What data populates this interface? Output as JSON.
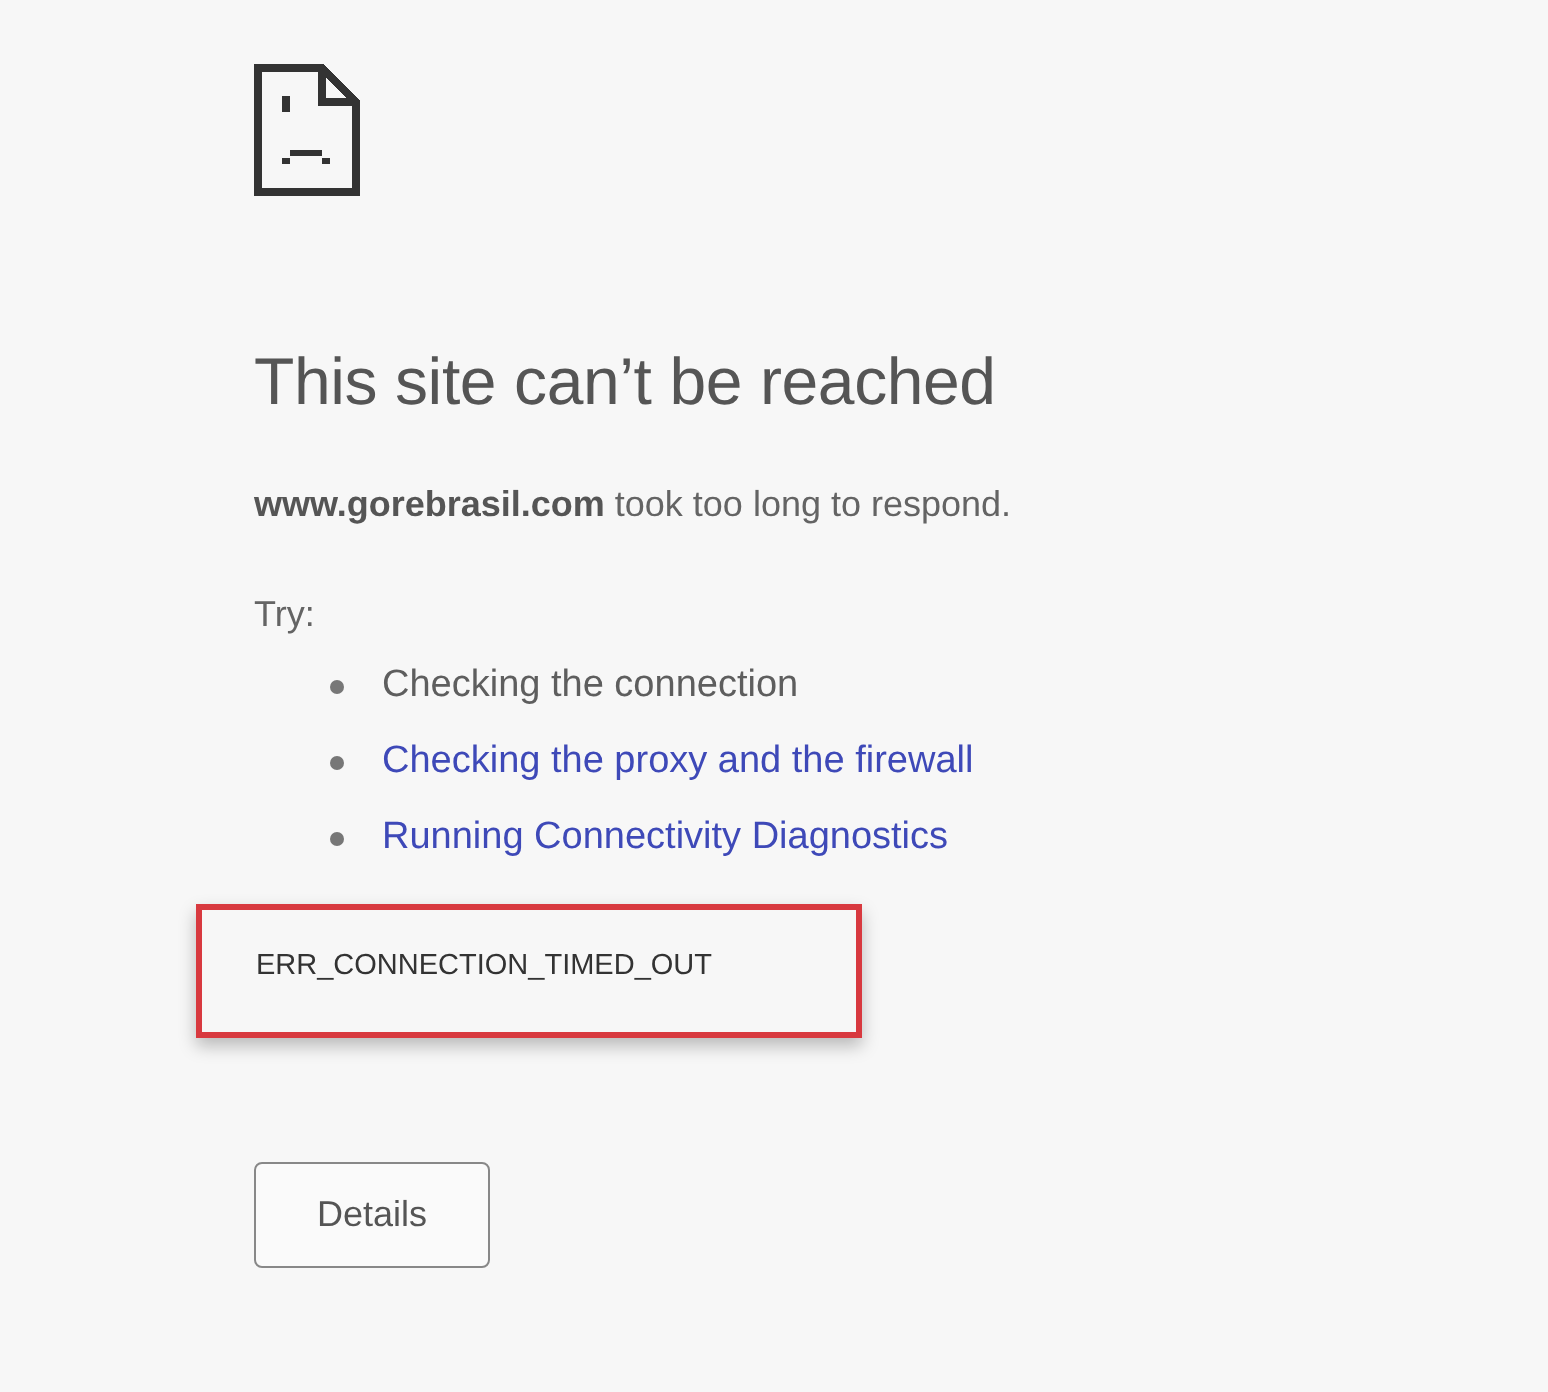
{
  "heading": "This site can’t be reached",
  "message": "**www.gorebrasil.com** took too long to respond.",
  "suggestions_intro": "Try:",
  "suggestions": [
    {
      "kind": "text",
      "label": "Checking the connection"
    },
    {
      "kind": "link",
      "label": "Checking the proxy and the firewall"
    },
    {
      "kind": "link",
      "label": "Running Connectivity Diagnostics"
    }
  ],
  "error_code": {
    "text": "ERR_CONNECTION_TIMED_OUT",
    "highlighted": true
  },
  "buttons": [
    "Details"
  ]
}
